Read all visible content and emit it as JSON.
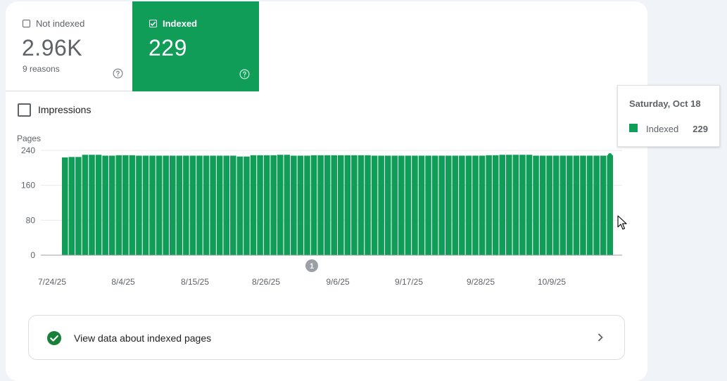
{
  "tiles": {
    "not_indexed": {
      "label": "Not indexed",
      "value": "2.96K",
      "sub": "9 reasons",
      "checked": false
    },
    "indexed": {
      "label": "Indexed",
      "value": "229",
      "checked": true
    }
  },
  "impressions": {
    "label": "Impressions",
    "checked": false
  },
  "tooltip": {
    "date": "Saturday, Oct 18",
    "series": "Indexed",
    "value": "229"
  },
  "link": {
    "label": "View data about indexed pages"
  },
  "colors": {
    "indexed": "#0f9d58",
    "axis": "#5f6368",
    "grid": "#e8eaed"
  },
  "chart_data": {
    "type": "bar",
    "ylabel": "Pages",
    "ylim": [
      0,
      240
    ],
    "yticks": [
      "240",
      "160",
      "80",
      "0"
    ],
    "xticks": [
      "7/24/25",
      "8/4/25",
      "8/15/25",
      "8/26/25",
      "9/6/25",
      "9/17/25",
      "9/28/25",
      "10/9/25"
    ],
    "annotation": "1",
    "series": [
      {
        "name": "Indexed",
        "values": [
          224,
          225,
          225,
          230,
          230,
          230,
          228,
          228,
          229,
          229,
          229,
          228,
          228,
          228,
          228,
          228,
          228,
          228,
          228,
          228,
          228,
          228,
          228,
          228,
          228,
          228,
          226,
          226,
          229,
          229,
          229,
          229,
          230,
          230,
          228,
          228,
          228,
          229,
          229,
          229,
          229,
          229,
          229,
          229,
          229,
          229,
          228,
          228,
          228,
          228,
          228,
          228,
          228,
          228,
          228,
          228,
          228,
          228,
          228,
          228,
          228,
          228,
          228,
          229,
          229,
          230,
          230,
          230,
          230,
          230,
          228,
          228,
          228,
          228,
          228,
          228,
          228,
          228,
          228,
          228,
          228,
          229
        ]
      }
    ]
  }
}
